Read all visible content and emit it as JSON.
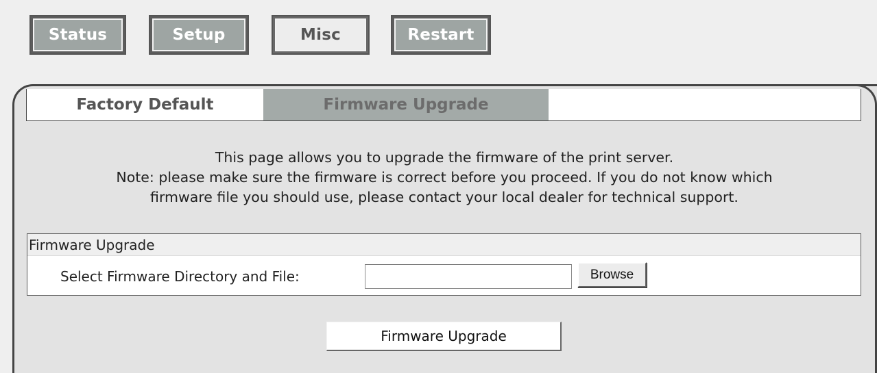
{
  "nav": {
    "status": "Status",
    "setup": "Setup",
    "misc": "Misc",
    "restart": "Restart"
  },
  "tabs": {
    "factory_default": "Factory Default",
    "firmware_upgrade": "Firmware Upgrade"
  },
  "description": {
    "line1": "This page allows you to upgrade the firmware of the print server.",
    "line2": "Note: please make sure the firmware is correct before you proceed. If you do not know which",
    "line3": "firmware file you should use, please contact your local dealer for technical support."
  },
  "upgrade_box": {
    "heading": "Firmware Upgrade",
    "file_label": "Select Firmware Directory and File:",
    "file_value": "",
    "browse_label": "Browse"
  },
  "upgrade_button_label": "Firmware Upgrade",
  "colors": {
    "nav_button_bg": "#9ea5a3",
    "active_tab_bg": "#a3aaa8",
    "panel_bg": "#e3e3e3"
  }
}
